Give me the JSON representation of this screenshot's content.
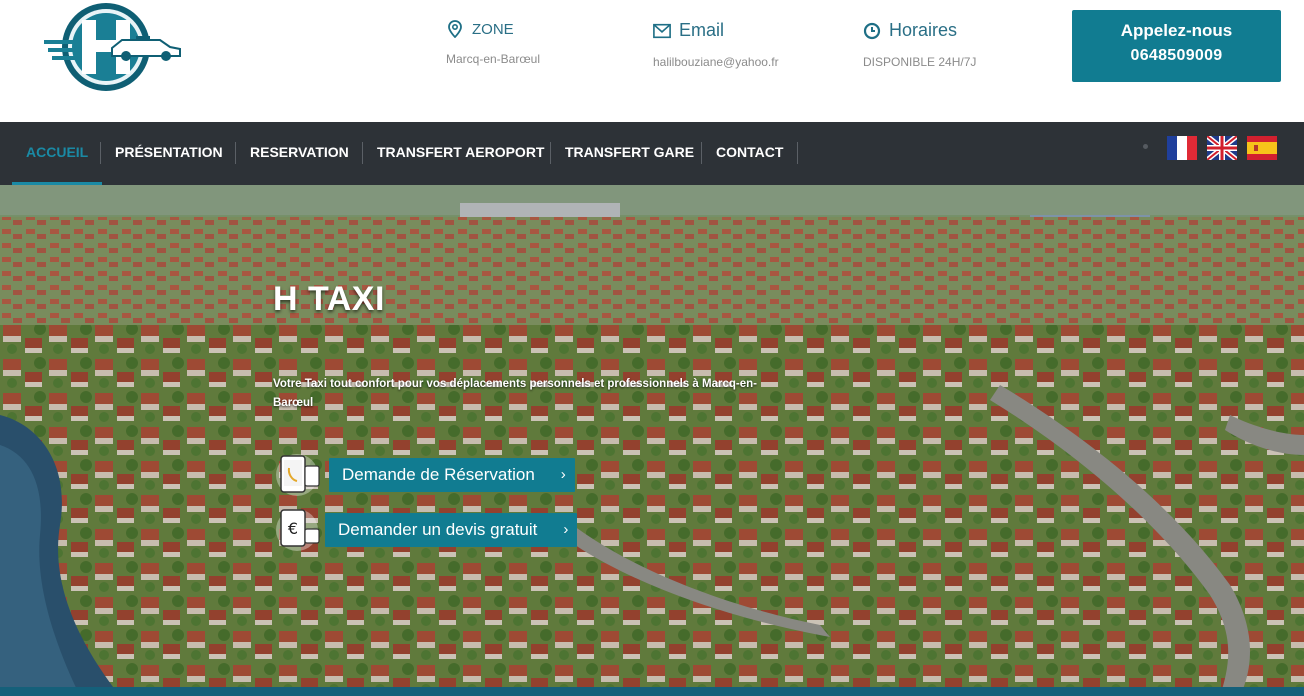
{
  "header": {
    "logo_icon": "h-taxi-logo",
    "zone": {
      "icon": "location-pin-icon",
      "label": "ZONE",
      "value": "Marcq-en-Barœul"
    },
    "email": {
      "icon": "envelope-icon",
      "label": "Email",
      "value": "halilbouziane@yahoo.fr"
    },
    "hours": {
      "icon": "clock-icon",
      "label": "Horaires",
      "value": "DISPONIBLE 24H/7J"
    },
    "call": {
      "line1": "Appelez-nous",
      "line2": "0648509009"
    }
  },
  "nav": {
    "items": [
      {
        "label": "ACCUEIL",
        "active": true
      },
      {
        "label": "PRÉSENTATION",
        "active": false
      },
      {
        "label": "RESERVATION",
        "active": false
      },
      {
        "label": "TRANSFERT AEROPORT",
        "active": false
      },
      {
        "label": "TRANSFERT GARE",
        "active": false
      },
      {
        "label": "CONTACT",
        "active": false
      }
    ],
    "flags": [
      "french-flag",
      "uk-flag",
      "spanish-flag"
    ]
  },
  "hero": {
    "title": "H TAXI",
    "text": "Votre Taxi tout confort pour vos déplacements personnels et professionnels à Marcq-en-Barœul",
    "cta1": {
      "label": "Demande de Réservation",
      "icon": "phone-reservation-icon"
    },
    "cta2": {
      "label": "Demander un devis gratuit",
      "icon": "euro-quote-icon"
    }
  },
  "colors": {
    "accent": "#117c91",
    "nav_bg": "#2d3237",
    "active": "#1a8aa5"
  }
}
